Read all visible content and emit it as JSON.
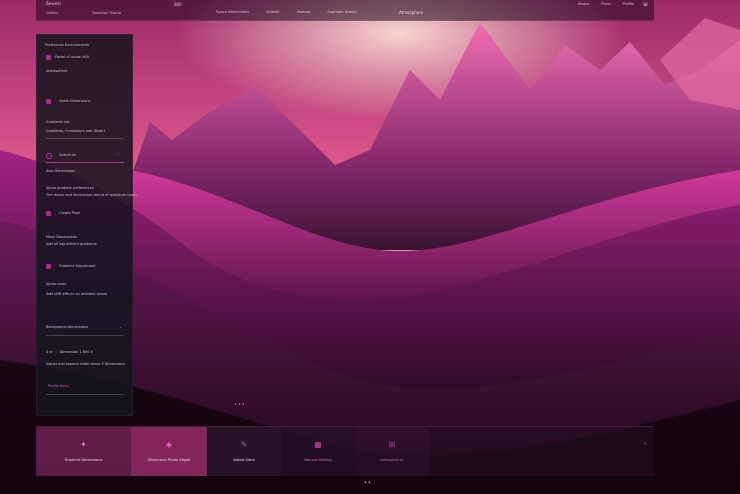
{
  "colors": {
    "accent": "#c02d96",
    "panel": "#16141e",
    "sky_top": "#b6327a",
    "sky_glow": "#ffd6cc"
  },
  "header": {
    "brand": "Seven",
    "small_label": "Still",
    "sub_tabs": [
      "Gallery",
      "Favorites Theme"
    ],
    "nav": [
      "Space Dimensions",
      "Sidebar",
      "Feature",
      "Spotlight Design"
    ],
    "center_title": "Atmosphere",
    "links": [
      "Status",
      "Plans",
      "Profile"
    ],
    "menu_icon": "hamburger-icon"
  },
  "sidebar": {
    "heading": "Preference Environments",
    "item1": {
      "icon": "square-icon",
      "label": "Pastel of visual 600"
    },
    "item1_sub": "Atmosphere",
    "item2": {
      "icon": "square-icon",
      "label": "Violet Dimensions"
    },
    "item2_sub": "Gradients set",
    "item2_sub2": "Gradients, Framework and Desert",
    "item3": {
      "icon": "circle-icon",
      "label": "Spectrum"
    },
    "item3_note": "Also Dimensions",
    "item3_sub": "Alpha gradient preferences",
    "item3_sub2": "The dunes and dimensions blend of spectrum tones",
    "item4": {
      "icon": "square-icon",
      "label": "Create Pixel"
    },
    "section2": "Mesh Dimensions",
    "section2_sub": "Add all adjustment gradients",
    "item5": {
      "icon": "square-icon",
      "label": "Gradient Adjustment"
    },
    "item5_sub": "Alpha cross",
    "item5_sub2": "Add shift effects on ambient dunes",
    "section3": "Background dimensions",
    "section3_values": "4  ≡  ◦  ◦  Dimension 1  600 0",
    "section3_sub": "Adjust and expand slider tones 3 Dimensions",
    "section3_link": "Profile hints"
  },
  "cards": [
    {
      "icon": "sparkle-icon",
      "label": "Gradient Dimensions"
    },
    {
      "icon": "gem-icon",
      "label": "Dimension Photo Edges"
    },
    {
      "icon": "pen-icon",
      "label": "Adjust Stars"
    },
    {
      "icon": "chart-icon",
      "label": "Natural Setting"
    },
    {
      "icon": "grid-icon",
      "label": "Atmospheres"
    }
  ],
  "strip_arrow": "›",
  "pager_mid": "•••",
  "pager_bottom": "••"
}
